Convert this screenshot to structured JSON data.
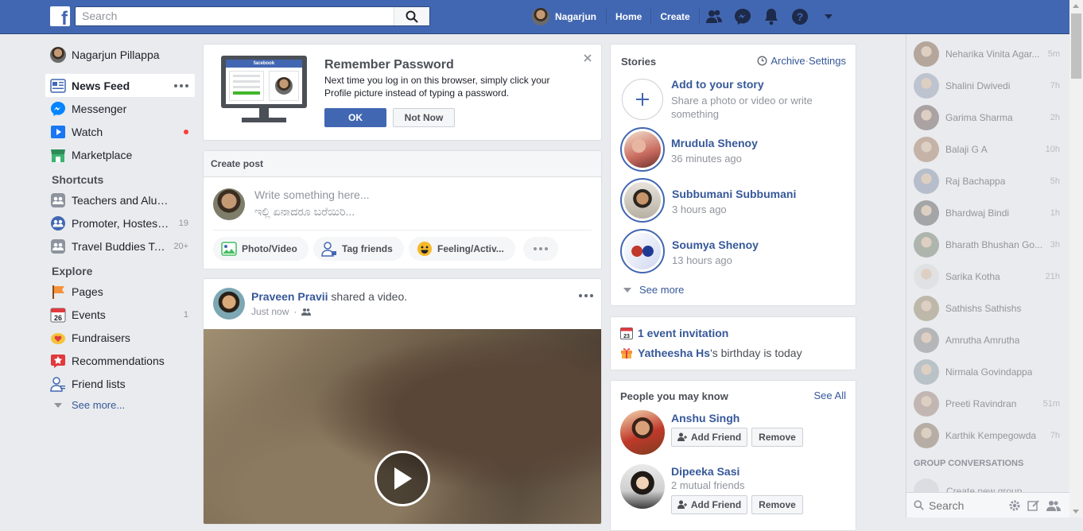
{
  "topbar": {
    "search_placeholder": "Search",
    "user_name": "Nagarjun",
    "home": "Home",
    "create": "Create"
  },
  "leftnav": {
    "profile": "Nagarjun Pillappa",
    "main": [
      {
        "label": "News Feed",
        "icon": "news-feed-icon"
      },
      {
        "label": "Messenger",
        "icon": "messenger-icon"
      },
      {
        "label": "Watch",
        "icon": "watch-icon"
      },
      {
        "label": "Marketplace",
        "icon": "marketplace-icon"
      }
    ],
    "shortcuts_title": "Shortcuts",
    "shortcuts": [
      {
        "label": "Teachers and Alum...",
        "count": ""
      },
      {
        "label": "Promoter, Hostess...",
        "count": "19"
      },
      {
        "label": "Travel Buddies Talk...",
        "count": "20+"
      }
    ],
    "explore_title": "Explore",
    "explore": [
      {
        "label": "Pages",
        "count": ""
      },
      {
        "label": "Events",
        "count": "1"
      },
      {
        "label": "Fundraisers",
        "count": ""
      },
      {
        "label": "Recommendations",
        "count": ""
      },
      {
        "label": "Friend lists",
        "count": ""
      }
    ],
    "see_more": "See more...",
    "events_day": "26"
  },
  "remember": {
    "title": "Remember Password",
    "body": "Next time you log in on this browser, simply click your Profile picture instead of typing a password.",
    "ok": "OK",
    "not_now": "Not Now",
    "mock_brand": "facebook"
  },
  "create_post": {
    "header": "Create post",
    "placeholder1": "Write something here...",
    "placeholder2": "ಇಲ್ಲಿ ಏನಾದರೂ ಬರೆಯಿರಿ...",
    "actions": [
      "Photo/Video",
      "Tag friends",
      "Feeling/Activ..."
    ]
  },
  "post": {
    "author": "Praveen Pravii",
    "action": " shared a video.",
    "time": "Just now"
  },
  "stories": {
    "title": "Stories",
    "archive": "Archive",
    "sep": " · ",
    "settings": "Settings",
    "add_title": "Add to your story",
    "add_sub": "Share a photo or video or write something",
    "items": [
      {
        "name": "Mrudula Shenoy",
        "time": "36 minutes ago"
      },
      {
        "name": "Subbumani Subbumani",
        "time": "3 hours ago"
      },
      {
        "name": "Soumya Shenoy",
        "time": "13 hours ago"
      }
    ],
    "see_more": "See more"
  },
  "events": {
    "invitation": "1 event invitation",
    "calendar_day": "23",
    "birthday_name": "Yatheesha Hs",
    "birthday_text": "'s birthday is today"
  },
  "pymk": {
    "title": "People you may know",
    "see_all": "See All",
    "people": [
      {
        "name": "Anshu Singh",
        "mutual": ""
      },
      {
        "name": "Dipeeka Sasi",
        "mutual": "2 mutual friends"
      }
    ],
    "add": "Add Friend",
    "remove": "Remove"
  },
  "chat": {
    "contacts": [
      {
        "name": "Neharika Vinita Agar...",
        "time": "5m"
      },
      {
        "name": "Shalini Dwivedi",
        "time": "7h"
      },
      {
        "name": "Garima Sharma",
        "time": "2h"
      },
      {
        "name": "Balaji G A",
        "time": "10h"
      },
      {
        "name": "Raj Bachappa",
        "time": "5h"
      },
      {
        "name": "Bhardwaj Bindi",
        "time": "1h"
      },
      {
        "name": "Bharath Bhushan Go...",
        "time": "3h"
      },
      {
        "name": "Sarika Kotha",
        "time": "21h"
      },
      {
        "name": "Sathishs Sathishs",
        "time": ""
      },
      {
        "name": "Amrutha Amrutha",
        "time": ""
      },
      {
        "name": "Nirmala Govindappa",
        "time": ""
      },
      {
        "name": "Preeti Ravindran",
        "time": "51m"
      },
      {
        "name": "Karthik Kempegowda",
        "time": "7h"
      }
    ],
    "group_title": "GROUP CONVERSATIONS",
    "create_group": "Create new group",
    "search_placeholder": "Search"
  }
}
